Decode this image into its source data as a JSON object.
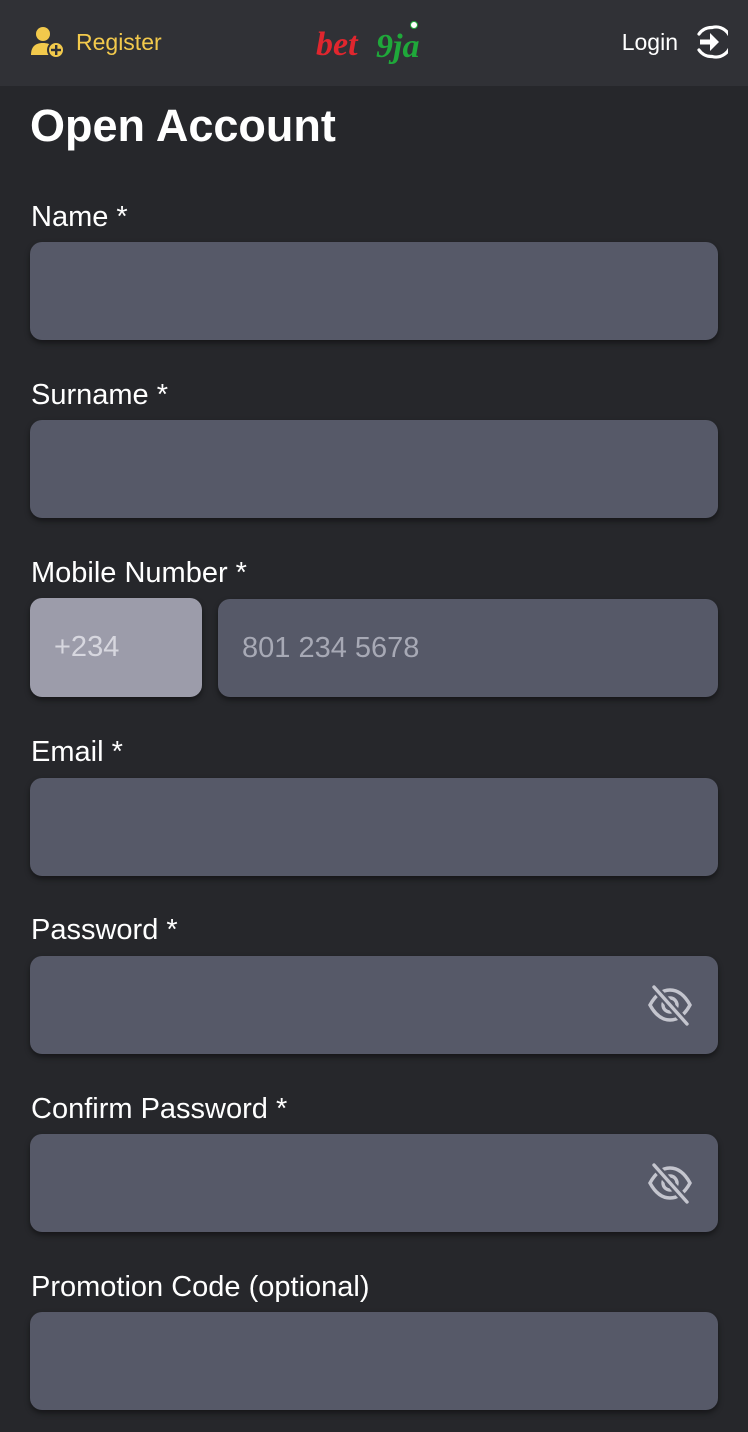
{
  "header": {
    "register_label": "Register",
    "logo_text_left": "bet",
    "logo_text_right": "9ja",
    "login_label": "Login"
  },
  "page_title": "Open Account",
  "fields": {
    "name": {
      "label": "Name *",
      "value": ""
    },
    "surname": {
      "label": "Surname *",
      "value": ""
    },
    "mobile": {
      "label": "Mobile Number *",
      "prefix": "+234",
      "placeholder": "801 234 5678",
      "value": ""
    },
    "email": {
      "label": "Email *",
      "value": ""
    },
    "password": {
      "label": "Password *",
      "value": ""
    },
    "confirm_password": {
      "label": "Confirm Password *",
      "value": ""
    },
    "promotion_code": {
      "label": "Promotion Code (optional)",
      "value": ""
    }
  },
  "colors": {
    "background": "#26272b",
    "header": "#303136",
    "input": "#565968",
    "prefix": "#9c9caa",
    "register_accent": "#f2c94c",
    "logo_red": "#e0262e",
    "logo_green": "#1fa83a"
  },
  "icons": {
    "register": "user-plus-icon",
    "login": "login-arrow-icon",
    "password_toggle": "eye-off-icon"
  }
}
